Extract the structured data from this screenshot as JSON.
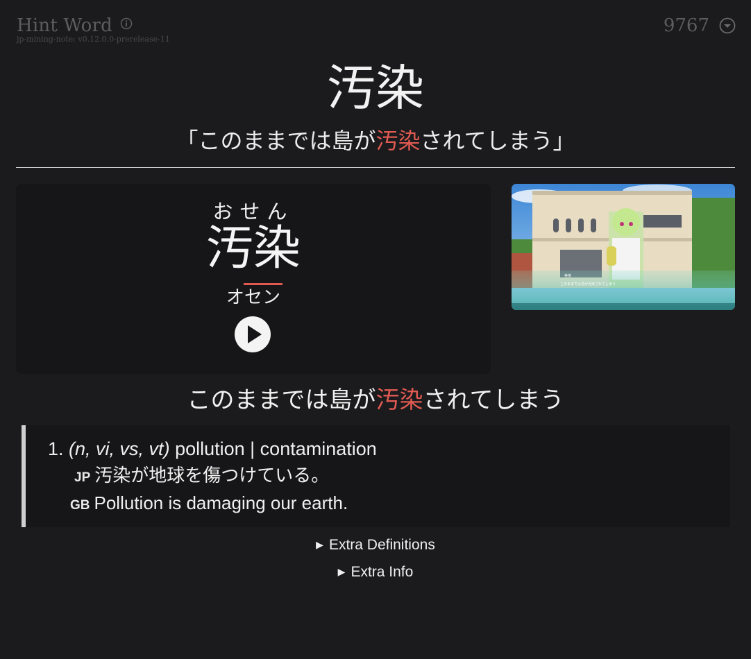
{
  "header": {
    "card_type": "Hint Word",
    "version": "jp-mining-note: v0.12.0.0-prerelease-11",
    "card_number": "9767"
  },
  "front": {
    "word": "汚染",
    "sentence_open": "「このままでは島が",
    "sentence_highlight": "汚染",
    "sentence_close": "されてしまう」"
  },
  "reading": {
    "furigana": "おせん",
    "kanji": "汚染",
    "katakana": "オセン"
  },
  "screenshot": {
    "caption_name": "美夜",
    "caption_text": "このままでは島が汚染されてしまう"
  },
  "sentence": {
    "before": "このままでは島が",
    "highlight": "汚染",
    "after": "されてしまう"
  },
  "definition": {
    "number": "1.",
    "pos": "(n, vi, vs, vt)",
    "gloss": "pollution | contamination",
    "examples": [
      {
        "tag": "JP",
        "text": "汚染が地球を傷つけている。"
      },
      {
        "tag": "GB",
        "text": "Pollution is damaging our earth."
      }
    ]
  },
  "collapsibles": {
    "extra_definitions": "Extra Definitions",
    "extra_info": "Extra Info"
  },
  "colors": {
    "background": "#1b1b1d",
    "highlight": "#e05a52",
    "panel": "#161618"
  }
}
